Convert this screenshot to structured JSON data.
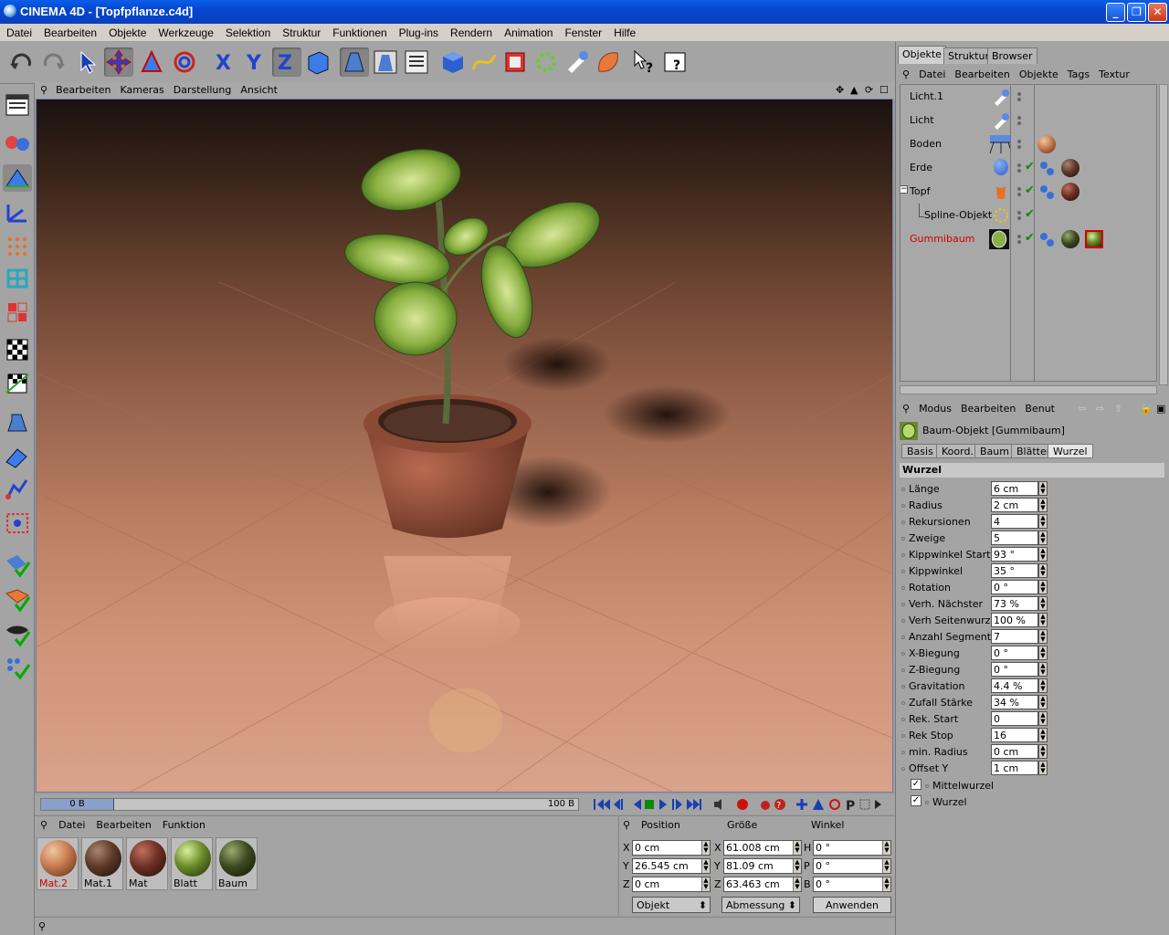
{
  "window": {
    "title": "CINEMA 4D - [Topfpflanze.c4d]"
  },
  "menu": [
    "Datei",
    "Bearbeiten",
    "Objekte",
    "Werkzeuge",
    "Selektion",
    "Struktur",
    "Funktionen",
    "Plug-ins",
    "Rendern",
    "Animation",
    "Fenster",
    "Hilfe"
  ],
  "toolbar_icons": [
    "undo-icon",
    "redo-icon",
    "select-arrow-icon",
    "move-icon",
    "scale-icon",
    "rotate-icon",
    "axis-x-icon",
    "axis-y-icon",
    "axis-z-icon",
    "world-coords-icon",
    "render-view-icon",
    "render-picture-icon",
    "render-settings-icon",
    "cube-icon",
    "spline-icon",
    "nurbs-icon",
    "array-icon",
    "deformer-icon",
    "light-icon",
    "environment-icon",
    "help-pointer-icon",
    "help-text-icon"
  ],
  "viewport": {
    "menu": [
      "Bearbeiten",
      "Kameras",
      "Darstellung",
      "Ansicht"
    ]
  },
  "timeline": {
    "current": "0 B",
    "end": "100 B"
  },
  "materials": {
    "menu": [
      "Datei",
      "Bearbeiten",
      "Funktion"
    ],
    "items": [
      {
        "label": "Mat.2",
        "color": "#c77a4f",
        "selected": true
      },
      {
        "label": "Mat.1",
        "color": "#5e3a2a",
        "selected": false
      },
      {
        "label": "Mat",
        "color": "#6d3124",
        "selected": false
      },
      {
        "label": "Blatt",
        "color": "#6c8c2a",
        "selected": false
      },
      {
        "label": "Baum",
        "color": "#3f4a22",
        "selected": false
      }
    ]
  },
  "coords": {
    "headers": {
      "position": "Position",
      "size": "Größe",
      "rotation": "Winkel"
    },
    "labels_pos": [
      "X",
      "Y",
      "Z"
    ],
    "labels_rot": [
      "H",
      "P",
      "B"
    ],
    "position": [
      "0 cm",
      "26.545 cm",
      "0 cm"
    ],
    "size": [
      "61.008 cm",
      "81.09 cm",
      "63.463 cm"
    ],
    "rotation": [
      "0 °",
      "0 °",
      "0 °"
    ],
    "mode": "Objekt",
    "measure": "Abmessung",
    "apply": "Anwenden"
  },
  "right_tabs": [
    "Objekte",
    "Struktur",
    "Browser"
  ],
  "object_menu": [
    "Datei",
    "Bearbeiten",
    "Objekte",
    "Tags",
    "Textur"
  ],
  "objects": [
    {
      "name": "Licht.1",
      "indent": 0
    },
    {
      "name": "Licht",
      "indent": 0
    },
    {
      "name": "Boden",
      "indent": 0
    },
    {
      "name": "Erde",
      "indent": 0
    },
    {
      "name": "Topf",
      "indent": 0
    },
    {
      "name": "Spline-Objekt",
      "indent": 1
    },
    {
      "name": "Gummibaum",
      "indent": 0,
      "selected": true
    }
  ],
  "attr": {
    "menu": [
      "Modus",
      "Bearbeiten",
      "Benut"
    ],
    "object_title": "Baum-Objekt [Gummibaum]",
    "tabs": [
      "Basis",
      "Koord.",
      "Baum",
      "Blätter",
      "Wurzel"
    ],
    "section": "Wurzel",
    "rows": [
      {
        "label": "Länge",
        "value": "6 cm"
      },
      {
        "label": "Radius",
        "value": "2 cm"
      },
      {
        "label": "Rekursionen",
        "value": "4"
      },
      {
        "label": "Zweige",
        "value": "5"
      },
      {
        "label": "Kippwinkel Start",
        "value": "93 °"
      },
      {
        "label": "Kippwinkel",
        "value": "35 °"
      },
      {
        "label": "Rotation",
        "value": "0 °"
      },
      {
        "label": "Verh. Nächster",
        "value": "73 %"
      },
      {
        "label": "Verh Seitenwurzel",
        "value": "100 %"
      },
      {
        "label": "Anzahl Segmente",
        "value": "7"
      },
      {
        "label": "X-Biegung",
        "value": "0 °"
      },
      {
        "label": "Z-Biegung",
        "value": "0 °"
      },
      {
        "label": "Gravitation",
        "value": "4.4 %"
      },
      {
        "label": "Zufall Stärke",
        "value": "34 %"
      },
      {
        "label": "Rek. Start",
        "value": "0"
      },
      {
        "label": "Rek Stop",
        "value": "16"
      },
      {
        "label": "min. Radius",
        "value": "0 cm"
      },
      {
        "label": "Offset Y",
        "value": "1 cm"
      }
    ],
    "checks": [
      {
        "label": "Mittelwurzel",
        "checked": true
      },
      {
        "label": "Wurzel",
        "checked": true
      }
    ]
  }
}
